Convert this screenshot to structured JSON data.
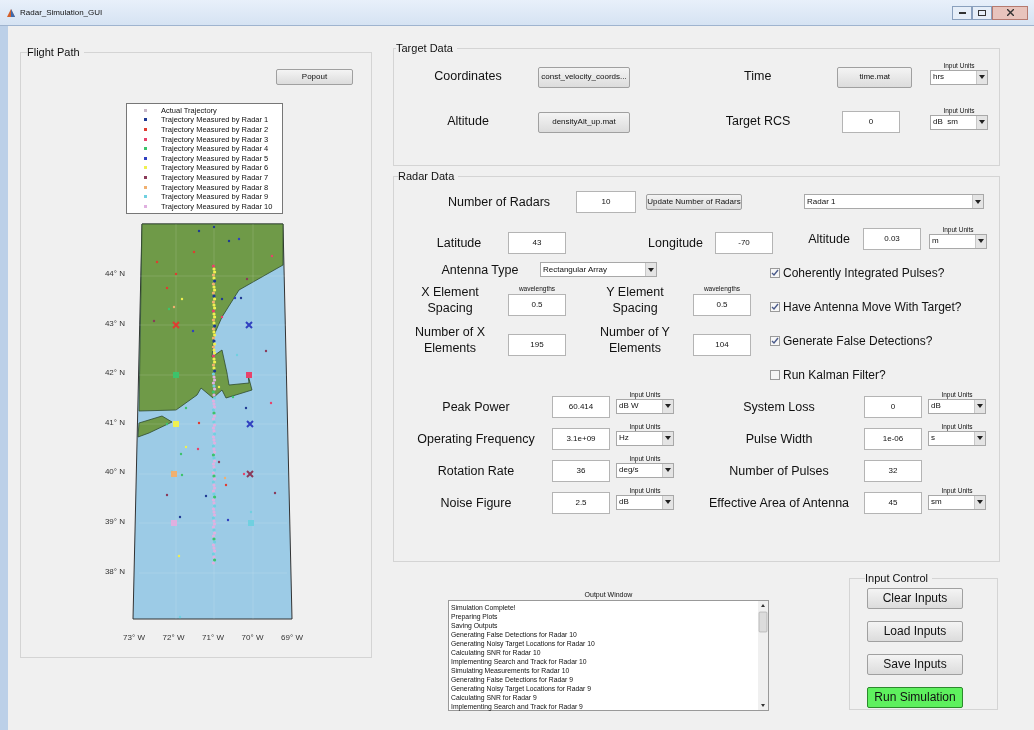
{
  "window": {
    "title": "Radar_Simulation_GUI"
  },
  "flight_path": {
    "title": "Flight Path",
    "popout": "Popout",
    "legend": [
      {
        "label": "Actual Trajectory",
        "color": "#c8b8c8"
      },
      {
        "label": "Trajectory Measured by Radar 1",
        "color": "#1f3a93"
      },
      {
        "label": "Trajectory Measured by Radar 2",
        "color": "#e03c31"
      },
      {
        "label": "Trajectory Measured by Radar 3",
        "color": "#e8426a"
      },
      {
        "label": "Trajectory Measured by Radar 4",
        "color": "#3cc36b"
      },
      {
        "label": "Trajectory Measured by Radar 5",
        "color": "#3040c0"
      },
      {
        "label": "Trajectory Measured by Radar 6",
        "color": "#f0f050"
      },
      {
        "label": "Trajectory Measured by Radar 7",
        "color": "#8a3a5a"
      },
      {
        "label": "Trajectory Measured by Radar 8",
        "color": "#f0b070"
      },
      {
        "label": "Trajectory Measured by Radar 9",
        "color": "#70d0e0"
      },
      {
        "label": "Trajectory Measured by Radar 10",
        "color": "#e0b0e0"
      }
    ],
    "lat_ticks": [
      "44° N",
      "43° N",
      "42° N",
      "41° N",
      "40° N",
      "39° N",
      "38° N"
    ],
    "lon_ticks": [
      "73° W",
      "72° W",
      "71° W",
      "70° W",
      "69° W"
    ]
  },
  "target_data": {
    "title": "Target Data",
    "rows": [
      [
        {
          "label": "Coordinates",
          "kind": "file",
          "value": "const_velocity_coords..."
        },
        {
          "label": "Time",
          "kind": "file",
          "value": "time.mat",
          "units_caption": "Input Units",
          "units": "hrs"
        }
      ],
      [
        {
          "label": "Altitude",
          "kind": "file",
          "value": "densityAlt_up.mat"
        },
        {
          "label": "Target RCS",
          "kind": "input",
          "value": "0",
          "units_caption": "Input Units",
          "units": "dB  sm"
        }
      ]
    ]
  },
  "radar_data": {
    "title": "Radar Data",
    "count_label": "Number of Radars",
    "count": "10",
    "update_button": "Update Number of Radars",
    "radar_select": "Radar 1",
    "position": [
      {
        "label": "Latitude",
        "value": "43"
      },
      {
        "label": "Longitude",
        "value": "-70"
      },
      {
        "label": "Altitude",
        "value": "0.03",
        "units_caption": "Input Units",
        "units": "m"
      }
    ],
    "antenna_label": "Antenna Type",
    "antenna_type": "Rectangular Array",
    "elements": [
      {
        "label": "X Element Spacing",
        "caption": "wavelengths",
        "value": "0.5"
      },
      {
        "label": "Y Element Spacing",
        "caption": "wavelengths",
        "value": "0.5"
      },
      {
        "label": "Number of X Elements",
        "value": "195"
      },
      {
        "label": "Number of Y Elements",
        "value": "104"
      }
    ],
    "options": [
      {
        "label": "Coherently Integrated Pulses?",
        "checked": true
      },
      {
        "label": "Have Antenna Move With Target?",
        "checked": true
      },
      {
        "label": "Generate False Detections?",
        "checked": true
      },
      {
        "label": "Run Kalman Filter?",
        "checked": false
      }
    ],
    "params": [
      [
        {
          "label": "Peak Power",
          "value": "60.414",
          "units_caption": "Input Units",
          "units": "dB W"
        },
        {
          "label": "System Loss",
          "value": "0",
          "units_caption": "Input Units",
          "units": "dB"
        }
      ],
      [
        {
          "label": "Operating Frequency",
          "value": "3.1e+09",
          "units_caption": "Input Units",
          "units": "Hz"
        },
        {
          "label": "Pulse Width",
          "value": "1e-06",
          "units_caption": "Input Units",
          "units": "s"
        }
      ],
      [
        {
          "label": "Rotation Rate",
          "value": "36",
          "units_caption": "Input Units",
          "units": "deg/s"
        },
        {
          "label": "Number of Pulses",
          "value": "32"
        }
      ],
      [
        {
          "label": "Noise Figure",
          "value": "2.5",
          "units_caption": "Input Units",
          "units": "dB"
        },
        {
          "label": "Effective Area of Antenna",
          "value": "45",
          "units_caption": "Input Units",
          "units": "sm"
        }
      ]
    ]
  },
  "output": {
    "title": "Output Window",
    "lines": [
      "Simulation Complete!",
      "Preparing Plots",
      "Saving Outputs",
      "Generating False Detections for Radar 10",
      "Generating Noisy Target Locations for Radar 10",
      "Calculating SNR for Radar 10",
      "Implementing Search and Track for Radar 10",
      "Simulating Measurements for Radar 10",
      "Generating False Detections for Radar 9",
      "Generating Noisy Target Locations for Radar 9",
      "Calculating SNR for Radar 9",
      "Implementing Search and Track for Radar 9"
    ]
  },
  "input_control": {
    "title": "Input Control",
    "buttons": [
      {
        "label": "Clear Inputs",
        "kind": "normal"
      },
      {
        "label": "Load Inputs",
        "kind": "normal"
      },
      {
        "label": "Save Inputs",
        "kind": "normal"
      },
      {
        "label": "Run Simulation",
        "kind": "run"
      }
    ]
  }
}
